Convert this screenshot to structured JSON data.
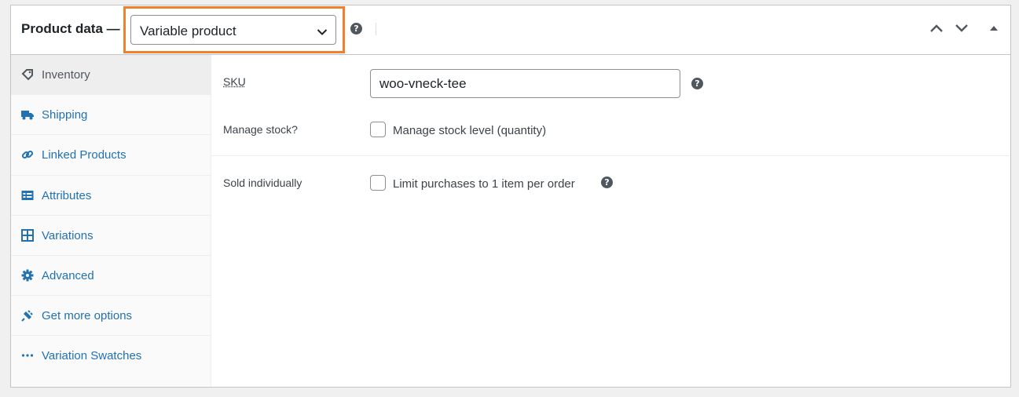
{
  "header": {
    "title": "Product data —",
    "product_type": "Variable product",
    "help_glyph": "?",
    "controls": [
      "move-up",
      "move-down",
      "toggle-panel"
    ]
  },
  "sidebar": {
    "items": [
      {
        "label": "Inventory",
        "icon": "tag-icon",
        "active": true
      },
      {
        "label": "Shipping",
        "icon": "truck-icon"
      },
      {
        "label": "Linked Products",
        "icon": "link-icon"
      },
      {
        "label": "Attributes",
        "icon": "list-card-icon"
      },
      {
        "label": "Variations",
        "icon": "grid-icon"
      },
      {
        "label": "Advanced",
        "icon": "gear-icon"
      },
      {
        "label": "Get more options",
        "icon": "plugin-icon"
      },
      {
        "label": "Variation Swatches",
        "icon": "ellipsis-icon"
      }
    ]
  },
  "inventory": {
    "sku_label": "SKU",
    "sku_value": "woo-vneck-tee",
    "manage_stock_label": "Manage stock?",
    "manage_stock_checkbox_label": "Manage stock level (quantity)",
    "manage_stock_checked": false,
    "sold_individually_label": "Sold individually",
    "sold_individually_checkbox_label": "Limit purchases to 1 item per order",
    "sold_individually_checked": false
  },
  "colors": {
    "link": "#2271b1",
    "highlight": "#f0802b",
    "border": "#c3c4c7"
  }
}
